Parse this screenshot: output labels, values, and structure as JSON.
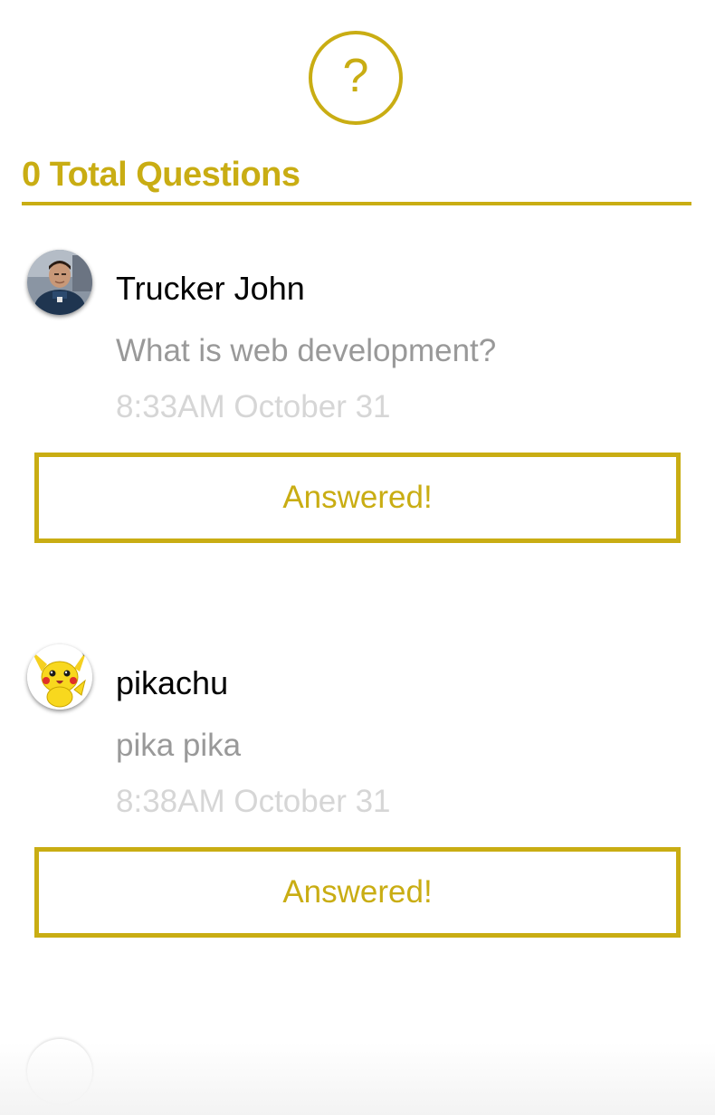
{
  "header": {
    "icon": "question-circle-icon",
    "icon_glyph": "?",
    "title": "0 Total Questions",
    "accent_color": "#c9ad13"
  },
  "questions": [
    {
      "user_name": "Trucker John",
      "avatar": "user-photo",
      "text": "What is web development?",
      "time": "8:33AM October 31",
      "button_label": "Answered!"
    },
    {
      "user_name": "pikachu",
      "avatar": "pikachu-avatar",
      "text": "pika pika",
      "time": "8:38AM October 31",
      "button_label": "Answered!"
    }
  ]
}
